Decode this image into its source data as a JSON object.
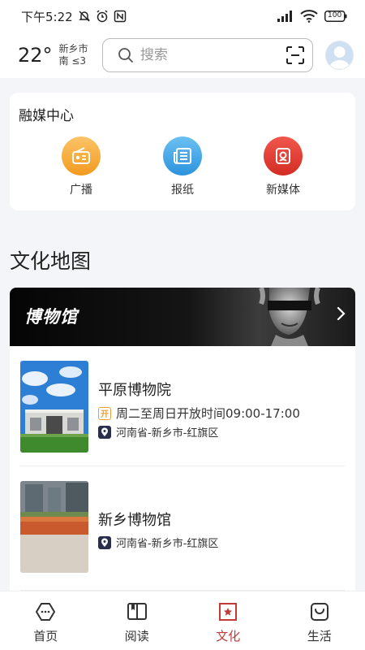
{
  "status_bar": {
    "time": "下午5:22",
    "battery": "100",
    "icons": [
      "mute-bell-icon",
      "alarm-icon",
      "nfc-icon",
      "signal-icon",
      "wifi-icon",
      "battery-icon"
    ]
  },
  "header": {
    "temperature": "22°",
    "city": "新乡市",
    "wind": "南 ≤3",
    "search_placeholder": "搜索",
    "icons": [
      "search-icon",
      "scan-icon",
      "avatar"
    ]
  },
  "media_center": {
    "title": "融媒中心",
    "items": [
      {
        "label": "广播",
        "icon": "radio-icon",
        "color": "#f6a623"
      },
      {
        "label": "报纸",
        "icon": "newspaper-icon",
        "color": "#3aa3e8"
      },
      {
        "label": "新媒体",
        "icon": "new-media-icon",
        "color": "#e23a30"
      }
    ]
  },
  "culture_map": {
    "title": "文化地图",
    "banner": {
      "title": "博物馆",
      "icon": "chevron-right-icon"
    },
    "museums": [
      {
        "name": "平原博物院",
        "hours_badge": "开",
        "hours": "周二至周日开放时间09:00-17:00",
        "address": "河南省-新乡市-红旗区"
      },
      {
        "name": "新乡博物馆",
        "address": "河南省-新乡市-红旗区"
      }
    ]
  },
  "bottom_nav": {
    "active": "文化",
    "active_color": "#c23b3b",
    "items": [
      {
        "label": "首页",
        "icon": "home-icon"
      },
      {
        "label": "阅读",
        "icon": "book-icon"
      },
      {
        "label": "文化",
        "icon": "culture-icon"
      },
      {
        "label": "生活",
        "icon": "life-bag-icon"
      }
    ]
  }
}
